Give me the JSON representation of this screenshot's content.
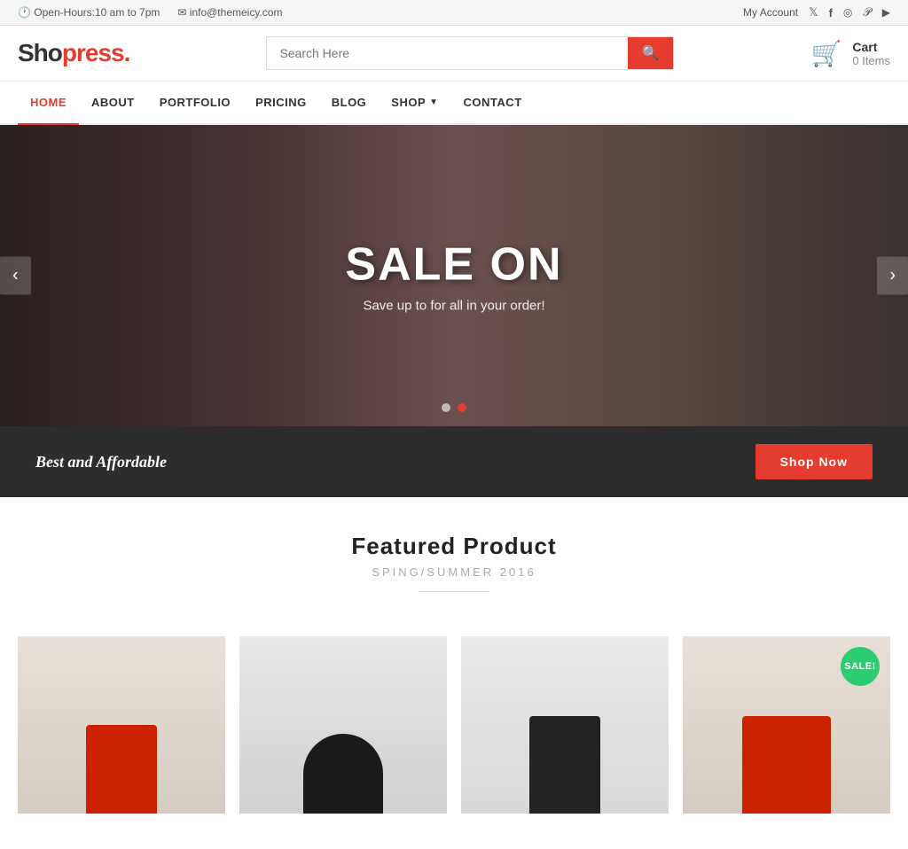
{
  "topbar": {
    "hours_icon": "🕐",
    "hours_text": "Open-Hours:10 am to 7pm",
    "email_icon": "✉",
    "email_text": "info@themeicy.com",
    "account_text": "My Account",
    "twitter_icon": "𝕏",
    "facebook_icon": "f",
    "instagram_icon": "📷",
    "pinterest_icon": "P",
    "youtube_icon": "▶"
  },
  "header": {
    "logo_text": "Shopress",
    "logo_dot": ".",
    "search_placeholder": "Search Here",
    "search_button_icon": "🔍",
    "cart_label": "Cart",
    "cart_items": "0 Items"
  },
  "nav": {
    "items": [
      {
        "label": "HOME",
        "active": true
      },
      {
        "label": "ABOUT",
        "active": false
      },
      {
        "label": "PORTFOLIO",
        "active": false
      },
      {
        "label": "PRICING",
        "active": false
      },
      {
        "label": "BLOG",
        "active": false
      },
      {
        "label": "SHOP",
        "active": false,
        "has_dropdown": true
      },
      {
        "label": "CONTACT",
        "active": false
      }
    ]
  },
  "hero": {
    "title": "SALE ON",
    "subtitle": "Save up to for all in your order!",
    "dot1_active": false,
    "dot2_active": true
  },
  "banner": {
    "text": "Best and Affordable",
    "button_label": "Shop Now"
  },
  "featured": {
    "title": "Featured Product",
    "subtitle": "SPING/SUMMER 2016"
  },
  "products": [
    {
      "has_sale": false
    },
    {
      "has_sale": false
    },
    {
      "has_sale": false
    },
    {
      "has_sale": true,
      "sale_label": "SALE!"
    }
  ]
}
